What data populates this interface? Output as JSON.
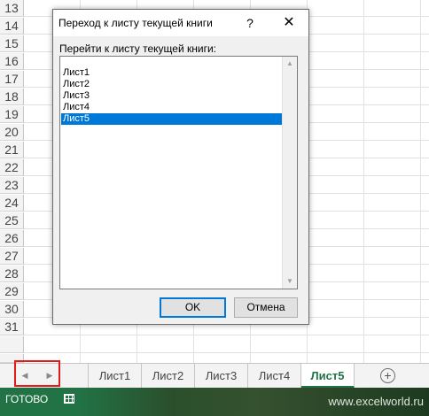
{
  "grid": {
    "row_numbers": [
      "13",
      "14",
      "15",
      "16",
      "17",
      "18",
      "19",
      "20",
      "21",
      "22",
      "23",
      "24",
      "25",
      "26",
      "27",
      "28",
      "29",
      "30",
      "31"
    ]
  },
  "dialog": {
    "title": "Переход к листу текущей книги",
    "help_label": "?",
    "close_label": "✕",
    "list_label": "Перейти к листу текущей книги:",
    "sheets": [
      "Лист1",
      "Лист2",
      "Лист3",
      "Лист4",
      "Лист5"
    ],
    "selected_index": 4,
    "ok_label": "OK",
    "cancel_label": "Отмена"
  },
  "tabbar": {
    "prev_icon": "◀",
    "next_icon": "▶",
    "tabs": [
      {
        "label": "Лист1",
        "active": false
      },
      {
        "label": "Лист2",
        "active": false
      },
      {
        "label": "Лист3",
        "active": false
      },
      {
        "label": "Лист4",
        "active": false
      },
      {
        "label": "Лист5",
        "active": true
      }
    ],
    "add_label": "+"
  },
  "statusbar": {
    "status": "ГОТОВО",
    "watermark": "www.excelworld.ru"
  },
  "colors": {
    "accent": "#217346",
    "selection": "#0078d7",
    "highlight_box": "#e21a1a"
  }
}
